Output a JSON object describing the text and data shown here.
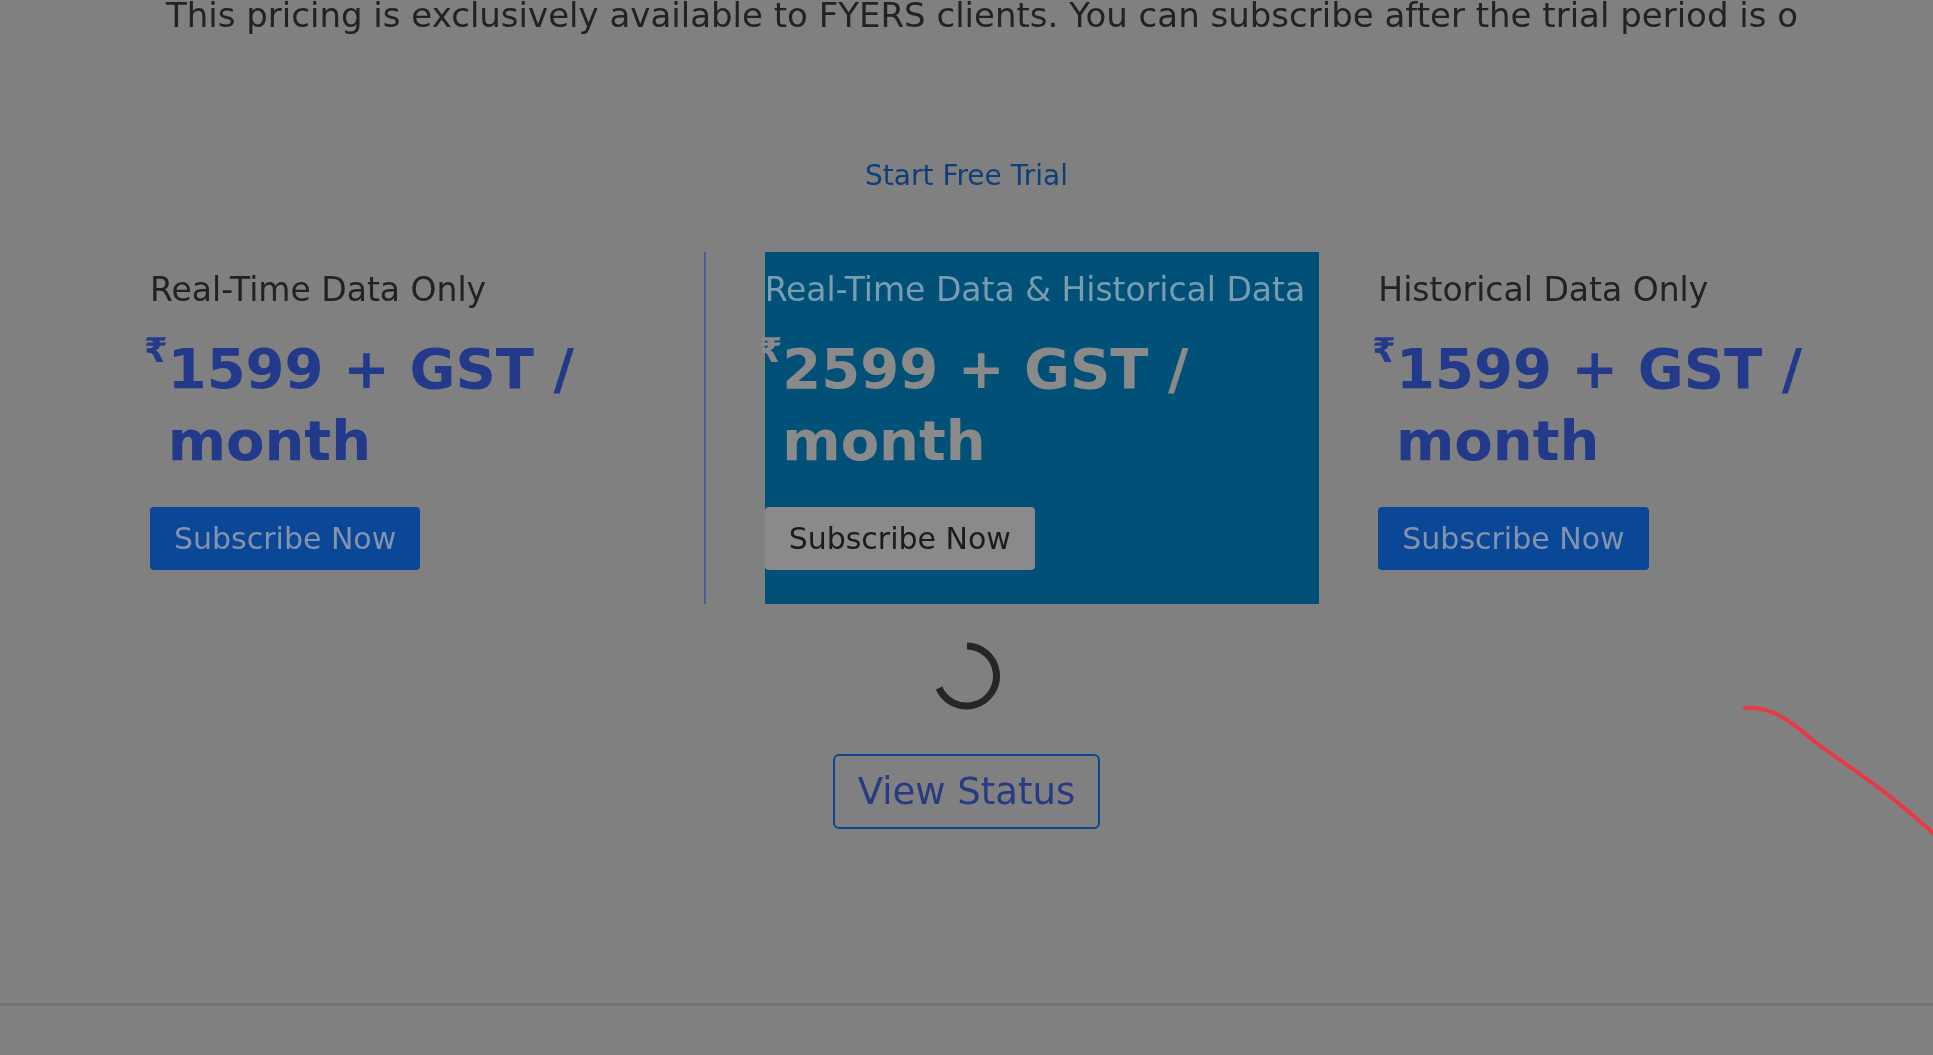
{
  "intro": "This pricing is exclusively available to FYERS clients. You can subscribe after the trial period is o",
  "trial_link": "Start Free Trial",
  "plans": [
    {
      "title": "Real-Time Data Only",
      "currency": "₹",
      "price": "1599 + GST / month",
      "button": "Subscribe Now",
      "selected": false
    },
    {
      "title": "Real-Time Data & Historical Data",
      "currency": "₹",
      "price": "2599 + GST / month",
      "button": "Subscribe Now",
      "selected": true
    },
    {
      "title": "Historical Data Only",
      "currency": "₹",
      "price": "1599 + GST / month",
      "button": "Subscribe Now",
      "selected": false
    }
  ],
  "status_button": "View Status"
}
